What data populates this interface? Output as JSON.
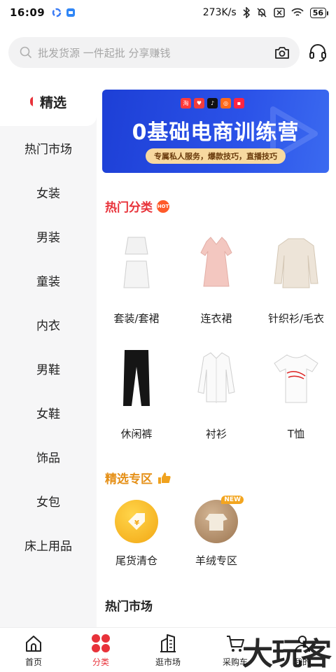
{
  "status_bar": {
    "time": "16:09",
    "network_speed": "273K/s",
    "battery": "56"
  },
  "search": {
    "placeholder": "批发货源 一件起批 分享赚钱"
  },
  "sidebar": {
    "items": [
      {
        "label": "精选",
        "active": true
      },
      {
        "label": "热门市场"
      },
      {
        "label": "女装"
      },
      {
        "label": "男装"
      },
      {
        "label": "童装"
      },
      {
        "label": "内衣"
      },
      {
        "label": "男鞋"
      },
      {
        "label": "女鞋"
      },
      {
        "label": "饰品"
      },
      {
        "label": "女包"
      },
      {
        "label": "床上用品"
      }
    ]
  },
  "banner": {
    "title": "0基础电商训练营",
    "subtitle": "专属私人服务，爆款技巧，直播技巧"
  },
  "sections": {
    "hot_category": {
      "title": "热门分类",
      "badge": "HOT"
    },
    "featured": {
      "title": "精选专区"
    },
    "hot_market": {
      "title": "热门市场"
    }
  },
  "categories": [
    {
      "label": "套装/套裙",
      "icon": "skirt-set-image"
    },
    {
      "label": "连衣裙",
      "icon": "dress-image"
    },
    {
      "label": "针织衫/毛衣",
      "icon": "sweater-image"
    },
    {
      "label": "休闲裤",
      "icon": "pants-image"
    },
    {
      "label": "衬衫",
      "icon": "shirt-image"
    },
    {
      "label": "T恤",
      "icon": "tshirt-image"
    }
  ],
  "featured_items": [
    {
      "label": "尾货清仓",
      "icon": "tag-icon",
      "color": "#f6b321"
    },
    {
      "label": "羊绒专区",
      "icon": "cashmere-icon",
      "color": "#b8936b",
      "badge": "NEW"
    }
  ],
  "bottom_nav": [
    {
      "label": "首页",
      "icon": "home-icon"
    },
    {
      "label": "分类",
      "icon": "category-icon",
      "active": true
    },
    {
      "label": "逛市场",
      "icon": "building-icon"
    },
    {
      "label": "采购车",
      "icon": "cart-icon"
    },
    {
      "label": "我的",
      "icon": "profile-icon"
    }
  ],
  "watermark": "大玩客",
  "colors": {
    "accent": "#e8323a",
    "featured_title": "#e59018",
    "banner_blue": "#2b52e8"
  }
}
